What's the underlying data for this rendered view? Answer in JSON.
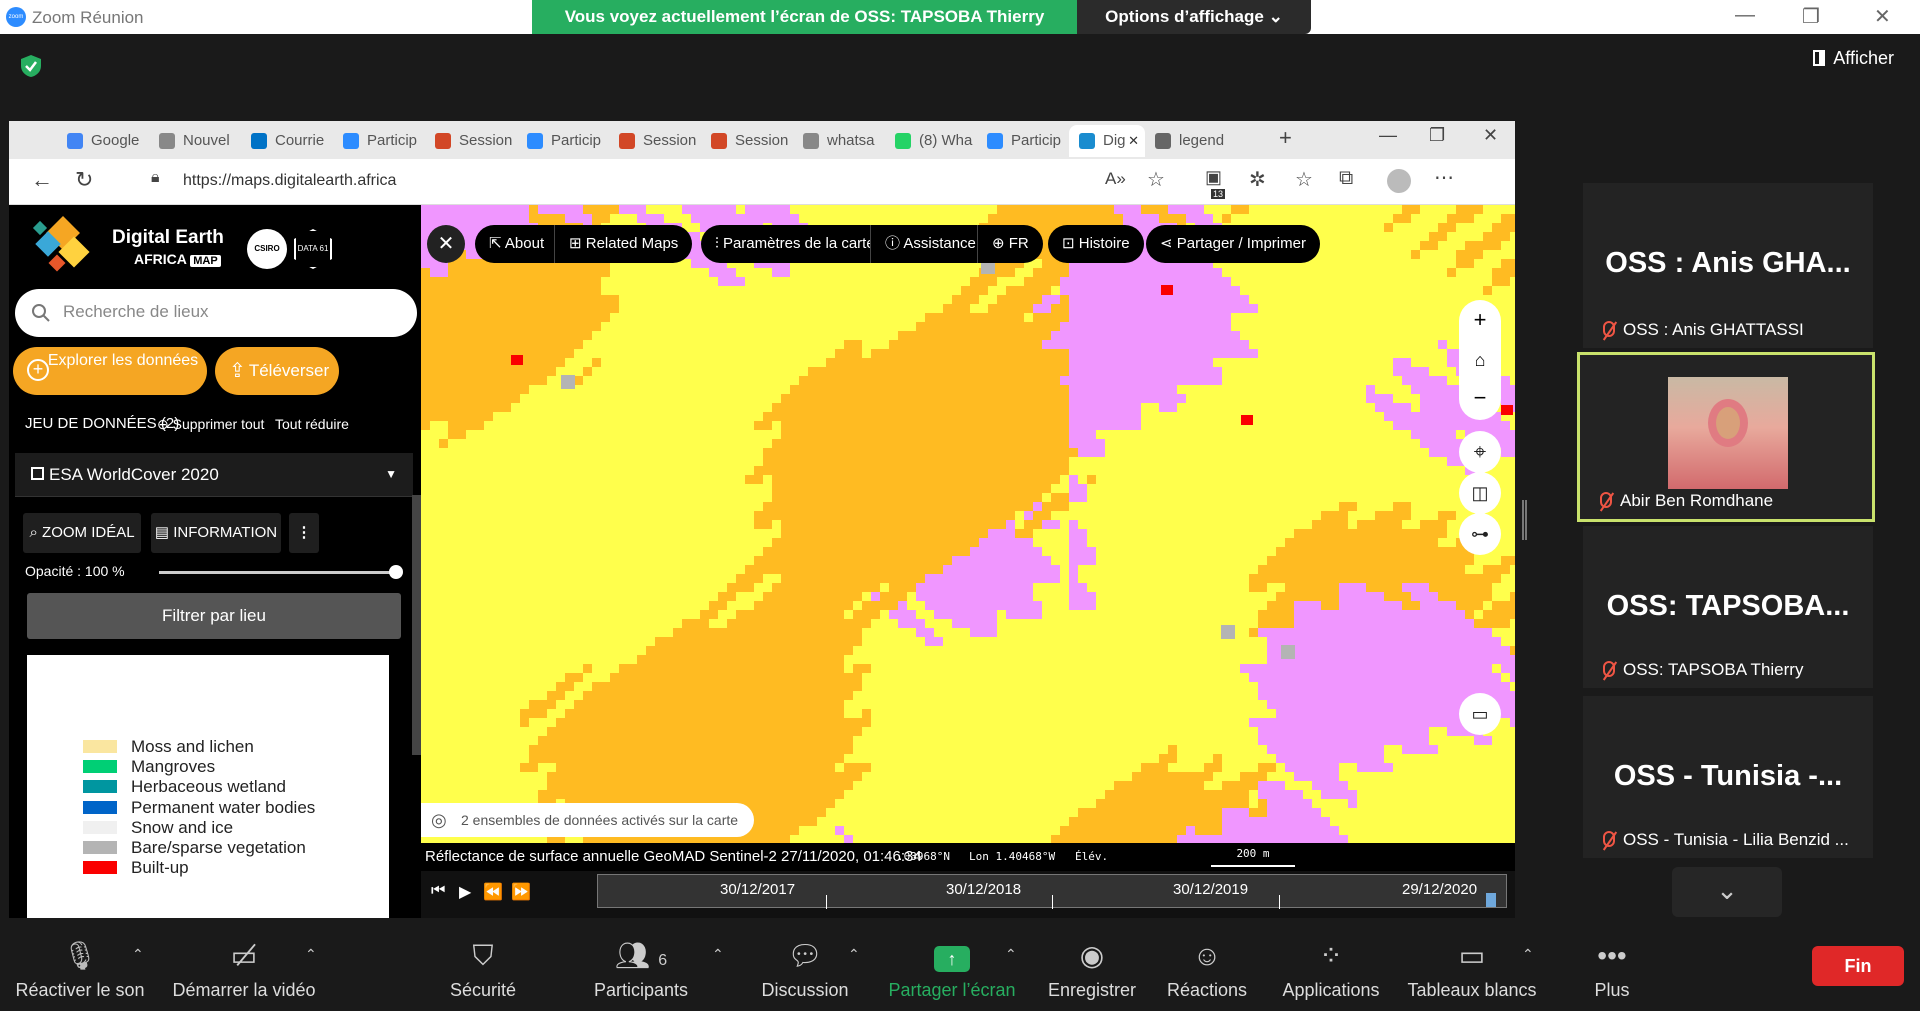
{
  "zoom": {
    "window_title": "Zoom Réunion",
    "share_banner": "Vous voyez actuellement l’écran de OSS: TAPSOBA Thierry",
    "view_options": "Options d’affichage ⌄",
    "afficher": "Afficher",
    "controls": {
      "minimize": "—",
      "restore": "❐",
      "close": "✕"
    }
  },
  "browser": {
    "tabs": [
      {
        "label": "Google",
        "color": "#4285f4"
      },
      {
        "label": "Nouvel",
        "color": "#888888"
      },
      {
        "label": "Courrie",
        "color": "#0072c6"
      },
      {
        "label": "Particip",
        "color": "#2d8cff"
      },
      {
        "label": "Session",
        "color": "#d24726"
      },
      {
        "label": "Particip",
        "color": "#2d8cff"
      },
      {
        "label": "Session",
        "color": "#d24726"
      },
      {
        "label": "Session",
        "color": "#d24726"
      },
      {
        "label": "whatsa",
        "color": "#888888"
      },
      {
        "label": "(8) Wha",
        "color": "#25d366"
      },
      {
        "label": "Particip",
        "color": "#2d8cff"
      },
      {
        "label": "Dig",
        "color": "#1a8ccf"
      },
      {
        "label": "legend",
        "color": "#666666"
      }
    ],
    "url": "https://maps.digitalearth.africa",
    "ext_badge": "13"
  },
  "panel": {
    "brand_title": "Digital Earth",
    "brand_sub": "AFRICA",
    "brand_map": "MAP",
    "csiro": "CSIRO",
    "data61": "DATA 61",
    "search_placeholder": "Recherche de lieux",
    "explore_label": "Explorer les données",
    "upload_label": "Téléverser",
    "datasets_label": "JEU DE DONNÉES (2)",
    "remove_all": "Supprimer tout",
    "collapse_all": "Tout réduire",
    "dataset_name": "ESA WorldCover 2020",
    "zoom_ideal": "ZOOM IDÉAL",
    "information": "INFORMATION",
    "opacity_label": "Opacité : 100 %",
    "opacity_value": 100,
    "filter_label": "Filtrer par lieu",
    "legend": [
      {
        "label": "Moss and lichen",
        "color": "#fae6a0"
      },
      {
        "label": "Mangroves",
        "color": "#00cf75"
      },
      {
        "label": "Herbaceous wetland",
        "color": "#0096a0"
      },
      {
        "label": "Permanent water bodies",
        "color": "#0064c8"
      },
      {
        "label": "Snow and ice",
        "color": "#f0f0f0"
      },
      {
        "label": "Bare/sparse vegetation",
        "color": "#b4b4b4"
      },
      {
        "label": "Built-up",
        "color": "#fa0000"
      }
    ]
  },
  "map": {
    "about": "About",
    "related_maps": "Related Maps",
    "map_params": "Paramètres de la carte",
    "assistance": "Assistance",
    "lang": "FR",
    "story": "Histoire",
    "share_print": "Partager / Imprimer",
    "active_datasets": "2 ensembles de données activés sur la carte",
    "status_text": "Réflectance de surface annuelle GeoMAD Sentinel-2 27/11/2020, 01:46:34",
    "lat": ".03968°N",
    "lon": "Lon  1.40468°W",
    "elev": "Élév.",
    "scale": "200 m",
    "timeline_dates": [
      "30/12/2017",
      "30/12/2018",
      "30/12/2019",
      "29/12/2020"
    ],
    "colors": {
      "cropland": "#ffff4c",
      "shrub": "#ffbb22",
      "grass": "#f096ff",
      "bare": "#b4b4b4",
      "built": "#fa0000"
    }
  },
  "participants": [
    {
      "big": "OSS : Anis GHA...",
      "name": "OSS : Anis GHATTASSI"
    },
    {
      "big": "",
      "name": "Abir Ben Romdhane"
    },
    {
      "big": "OSS:  TAPSOBA...",
      "name": "OSS: TAPSOBA Thierry"
    },
    {
      "big": "OSS  -  Tunisia  -...",
      "name": "OSS - Tunisia - Lilia Benzid ..."
    }
  ],
  "toolbar": {
    "unmute": "Réactiver le son",
    "start_video": "Démarrer la vidéo",
    "security": "Sécurité",
    "participants": "Participants",
    "participants_count": "6",
    "chat": "Discussion",
    "share": "Partager l’écran",
    "record": "Enregistrer",
    "reactions": "Réactions",
    "apps": "Applications",
    "whiteboards": "Tableaux blancs",
    "more": "Plus",
    "end": "Fin"
  }
}
